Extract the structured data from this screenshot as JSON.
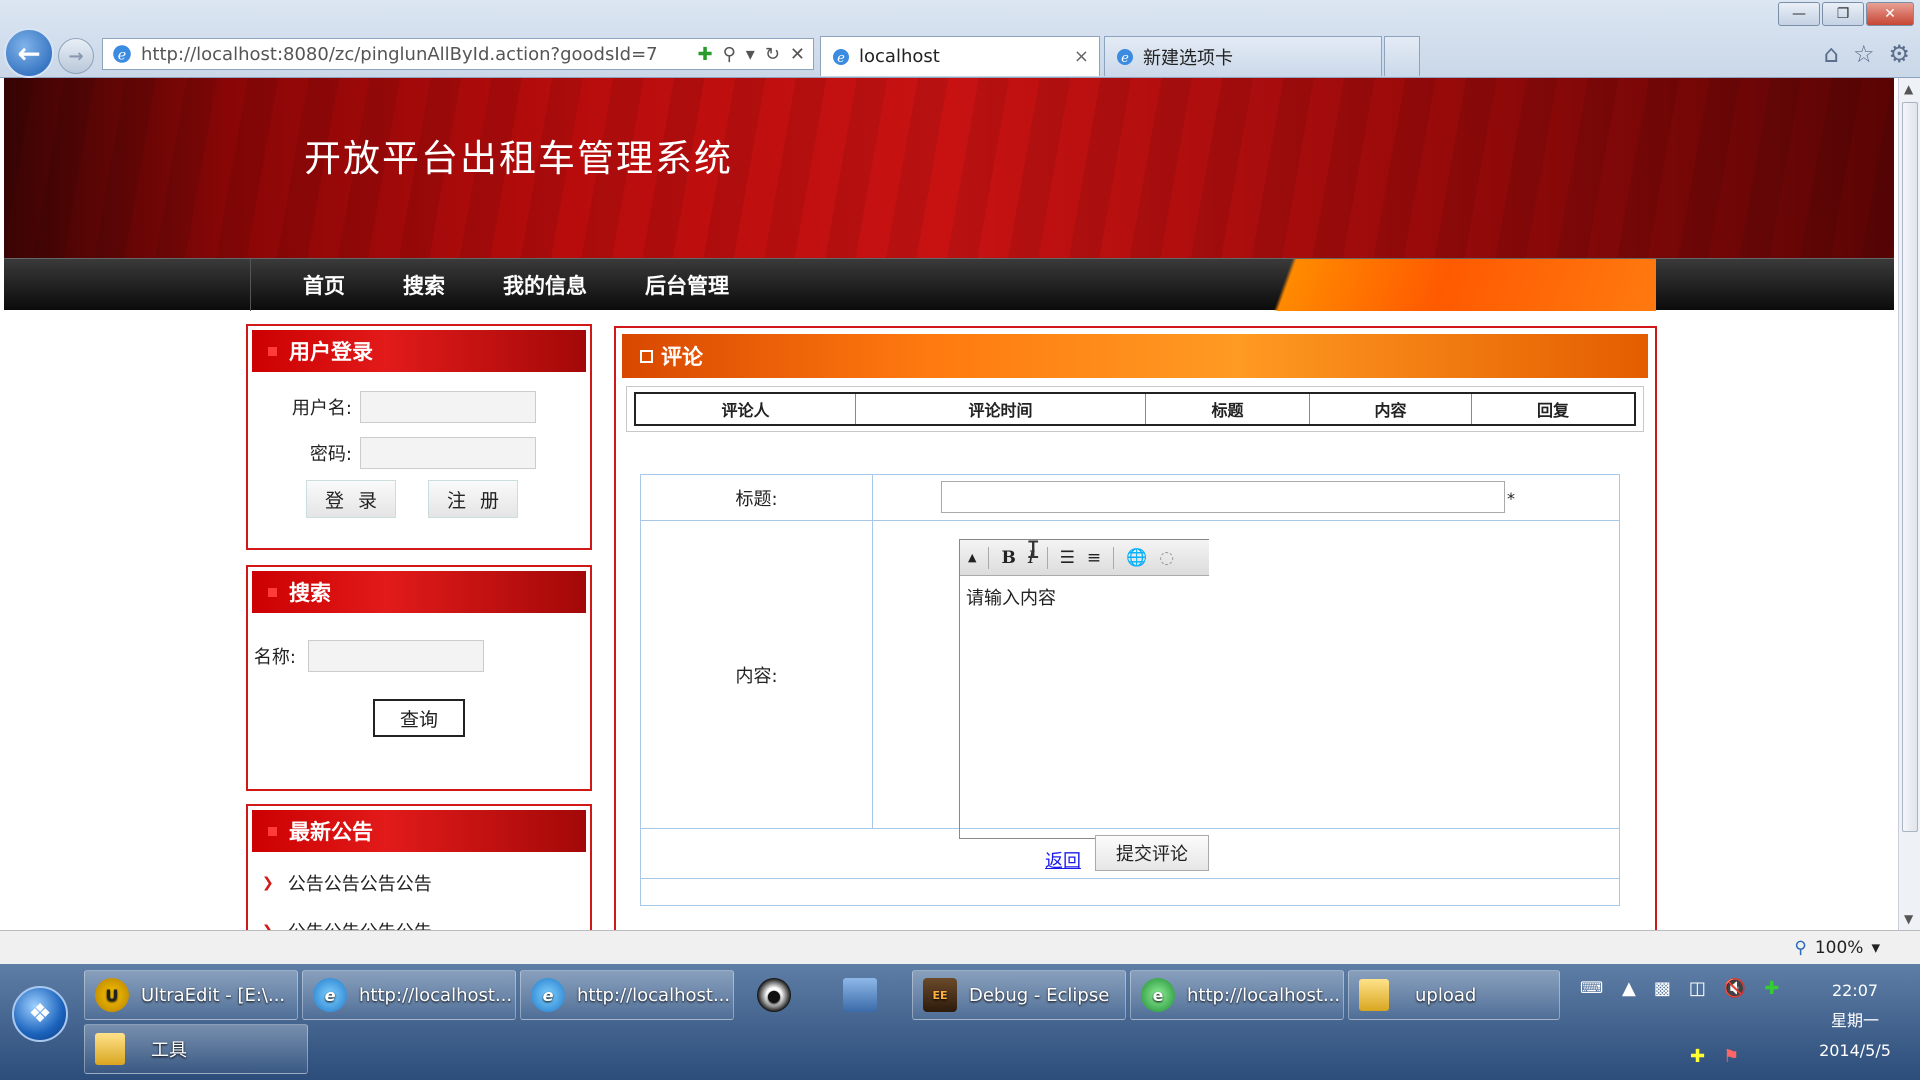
{
  "browser": {
    "url": "http://localhost:8080/zc/pinglunAllById.action?goodsId=7",
    "tabs": [
      {
        "label": "localhost",
        "close": "×"
      },
      {
        "label": "新建选项卡"
      }
    ],
    "zoom": "100%"
  },
  "site": {
    "title": "开放平台出租车管理系统",
    "nav": [
      "首页",
      "搜索",
      "我的信息",
      "后台管理"
    ]
  },
  "login": {
    "header": "用户登录",
    "username_label": "用户名:",
    "password_label": "密码:",
    "login_btn": "登录",
    "register_btn": "注册"
  },
  "search": {
    "header": "搜索",
    "name_label": "名称:",
    "query_btn": "查询"
  },
  "notice": {
    "header": "最新公告",
    "items": [
      "公告公告公告公告",
      "公告公告公告公告"
    ]
  },
  "comments": {
    "header": "评论",
    "columns": [
      "评论人",
      "评论时间",
      "标题",
      "内容",
      "回复"
    ],
    "form": {
      "title_label": "标题:",
      "required_mark": "*",
      "content_label": "内容:",
      "editor_placeholder": "请输入内容",
      "back_link": "返回",
      "submit_btn": "提交评论"
    }
  },
  "taskbar": {
    "buttons": [
      {
        "label": "UltraEdit - [E:\\...",
        "icon": "ultraedit-icon"
      },
      {
        "label": "http://localhost...",
        "icon": "ie-icon"
      },
      {
        "label": "http://localhost...",
        "icon": "ie-icon"
      },
      {
        "label": "Debug - Eclipse",
        "icon": "eclipse-icon"
      },
      {
        "label": "http://localhost...",
        "icon": "ie-green-icon"
      },
      {
        "label": "upload",
        "icon": "folder-icon"
      },
      {
        "label": "工具",
        "icon": "folder-icon"
      }
    ],
    "clock": {
      "time": "22:07",
      "weekday": "星期一",
      "date": "2014/5/5"
    }
  }
}
